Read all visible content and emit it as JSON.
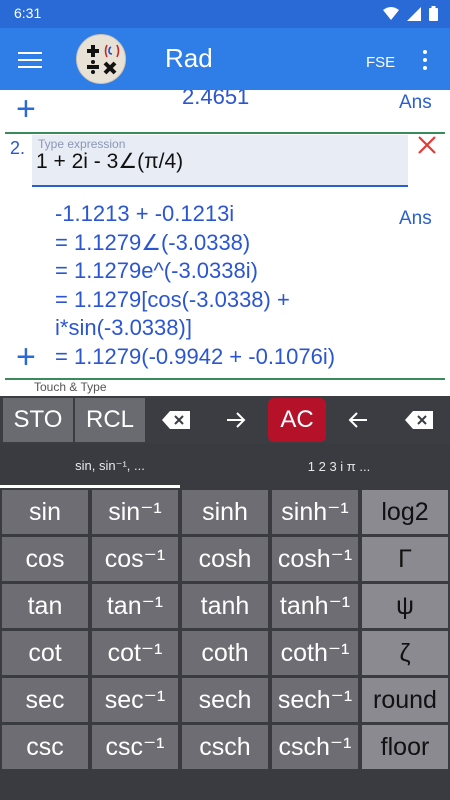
{
  "status": {
    "time": "6:31"
  },
  "app_bar": {
    "title": "Rad",
    "fse_label": "FSE"
  },
  "prev_entry": {
    "result": "2.4651",
    "ans_label": "Ans"
  },
  "entry": {
    "number": "2.",
    "placeholder": "Type expression",
    "expression": "1 + 2i - 3∠(π/4)",
    "ans_label": "Ans",
    "result_lines": [
      "-1.1213 + -0.1213i",
      "= 1.1279∠(-3.0338)",
      "= 1.1279e^(-3.0338i)",
      "= 1.1279[cos(-3.0338) +",
      "i*sin(-3.0338)]",
      "= 1.1279(-0.9942 + -0.1076i)"
    ]
  },
  "next_entry": {
    "hint": "Touch & Type"
  },
  "toolbar": {
    "sto_label": "STO",
    "rcl_label": "RCL",
    "ac_label": "AC"
  },
  "tabs": [
    {
      "label": "sin, sin⁻¹, ..."
    },
    {
      "label": "1 2 3 i π ..."
    }
  ],
  "keypad": {
    "rows": [
      [
        "sin",
        "sin⁻¹",
        "sinh",
        "sinh⁻¹",
        "log2"
      ],
      [
        "cos",
        "cos⁻¹",
        "cosh",
        "cosh⁻¹",
        "Γ"
      ],
      [
        "tan",
        "tan⁻¹",
        "tanh",
        "tanh⁻¹",
        "ψ"
      ],
      [
        "cot",
        "cot⁻¹",
        "coth",
        "coth⁻¹",
        "ζ"
      ],
      [
        "sec",
        "sec⁻¹",
        "sech",
        "sech⁻¹",
        "round"
      ],
      [
        "csc",
        "csc⁻¹",
        "csch",
        "csch⁻¹",
        "floor"
      ]
    ]
  },
  "colors": {
    "app_bar": "#2f7de6",
    "status_bar": "#2a6ad6",
    "accent_blue": "#2b55d2",
    "ac_red": "#b5122a",
    "close_red": "#e53935",
    "key_gray": "#6d6d73",
    "key_light": "#8a8a90"
  }
}
